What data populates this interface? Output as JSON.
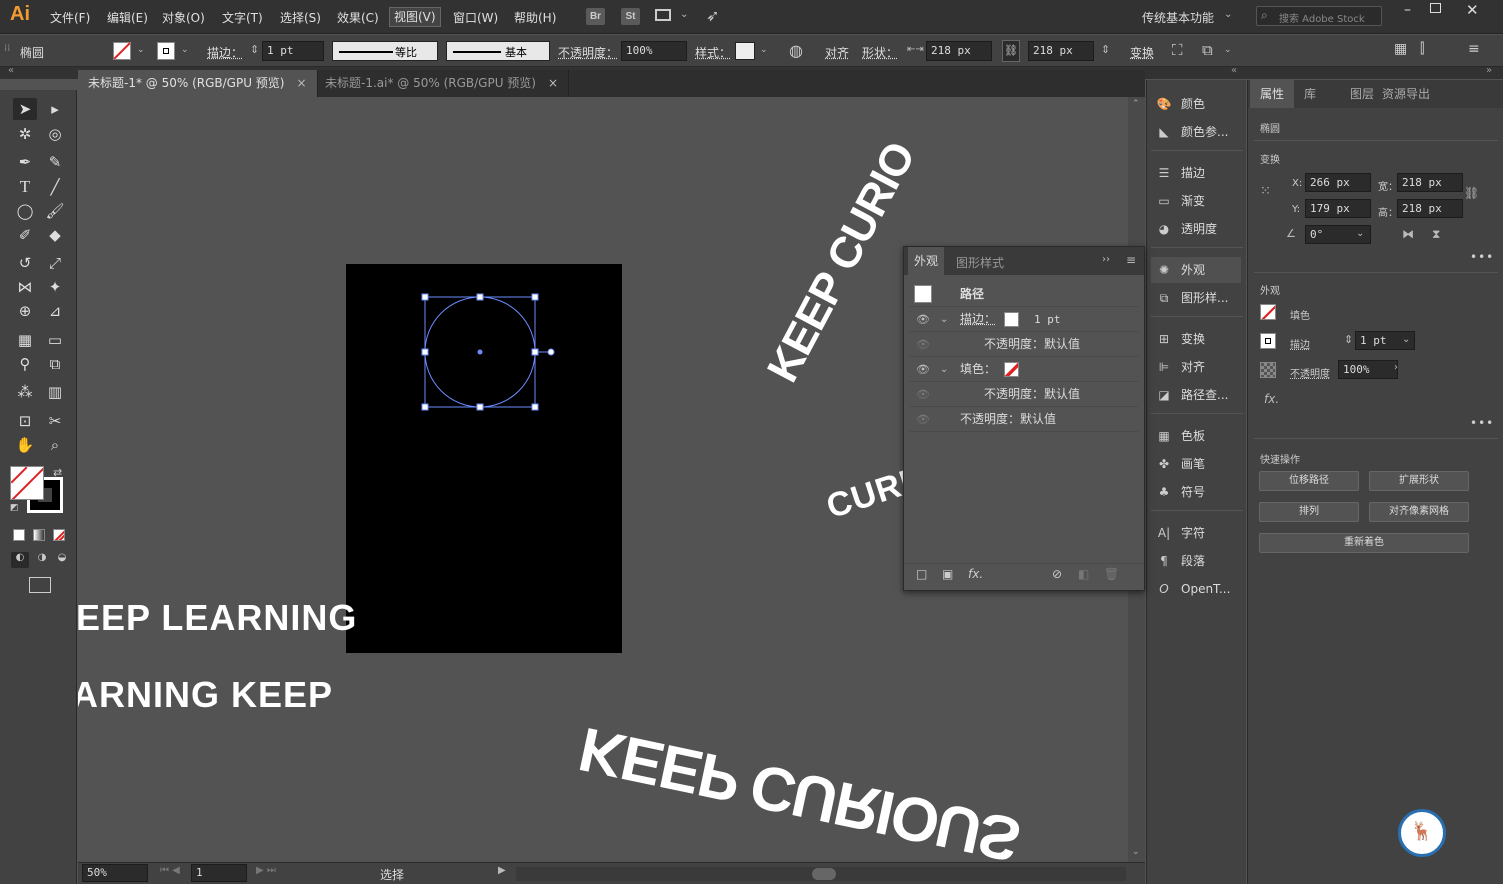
{
  "menu": {
    "logo": "Ai",
    "items": [
      "文件(F)",
      "编辑(E)",
      "对象(O)",
      "文字(T)",
      "选择(S)",
      "效果(C)",
      "视图(V)",
      "窗口(W)",
      "帮助(H)"
    ],
    "br": "Br",
    "st": "St",
    "workspace": "传统基本功能",
    "stock_placeholder": "搜索 Adobe Stock"
  },
  "control": {
    "object_type": "椭圆",
    "stroke_label": "描边：",
    "stroke_value": "1 pt",
    "profile_label": "等比",
    "brush_label": "基本",
    "opacity_label": "不透明度：",
    "opacity_value": "100%",
    "style_label": "样式：",
    "align_label": "对齐",
    "shape_label": "形状：",
    "width_value": "218 px",
    "height_value": "218 px",
    "transform_label": "变换"
  },
  "tabs": [
    {
      "label": "未标题-1* @ 50% (RGB/GPU 预览)",
      "close": "×"
    },
    {
      "label": "未标题-1.ai* @ 50% (RGB/GPU 预览)",
      "close": "×"
    }
  ],
  "canvas": {
    "text1": "EEP LEARNING",
    "text2": "ARNING KEEP",
    "arc_text1": "KEEP CURIO",
    "arc_text2": "CURIO",
    "arc_text3": "KEEP CURIOUS"
  },
  "status": {
    "zoom": "50%",
    "page": "1",
    "tool": "选择"
  },
  "panel_icons": [
    {
      "label": "颜色",
      "icon": "palette-icon"
    },
    {
      "label": "颜色参...",
      "icon": "color-guide-icon"
    },
    {
      "label": "描边",
      "icon": "stroke-icon"
    },
    {
      "label": "渐变",
      "icon": "gradient-icon"
    },
    {
      "label": "透明度",
      "icon": "transparency-icon"
    },
    {
      "label": "外观",
      "icon": "appearance-icon"
    },
    {
      "label": "图形样...",
      "icon": "graphic-styles-icon"
    },
    {
      "label": "变换",
      "icon": "transform-icon"
    },
    {
      "label": "对齐",
      "icon": "align-icon"
    },
    {
      "label": "路径查...",
      "icon": "pathfinder-icon"
    },
    {
      "label": "色板",
      "icon": "swatches-icon"
    },
    {
      "label": "画笔",
      "icon": "brushes-icon"
    },
    {
      "label": "符号",
      "icon": "symbols-icon"
    },
    {
      "label": "字符",
      "icon": "character-icon"
    },
    {
      "label": "段落",
      "icon": "paragraph-icon"
    },
    {
      "label": "OpenT...",
      "icon": "opentype-icon"
    }
  ],
  "appearance": {
    "tab1": "外观",
    "tab2": "图形样式",
    "path": "路径",
    "stroke_label": "描边：",
    "stroke_value": "1 pt",
    "opacity_default": "不透明度：默认值",
    "fill_label": "填色：",
    "fx": "fx."
  },
  "properties": {
    "tabs": [
      "属性",
      "库",
      "图层",
      "资源导出"
    ],
    "object": "椭圆",
    "transform": "变换",
    "x_label": "X:",
    "x": "266 px",
    "y_label": "Y:",
    "y": "179 px",
    "w_label": "宽：",
    "w": "218 px",
    "h_label": "高：",
    "h": "218 px",
    "angle": "0°",
    "appearance": "外观",
    "fill": "填色",
    "stroke": "描边",
    "stroke_value": "1 pt",
    "opacity": "不透明度",
    "opacity_value": "100%",
    "fx": "fx.",
    "quick_actions": "快速操作",
    "btn_offset": "位移路径",
    "btn_expand": "扩展形状",
    "btn_arrange": "排列",
    "btn_align_pixel": "对齐像素网格",
    "btn_recolor": "重新着色"
  },
  "colors": {
    "accent": "#6a8cff",
    "logo": "#f29b33",
    "nofill_red": "#e02020"
  }
}
